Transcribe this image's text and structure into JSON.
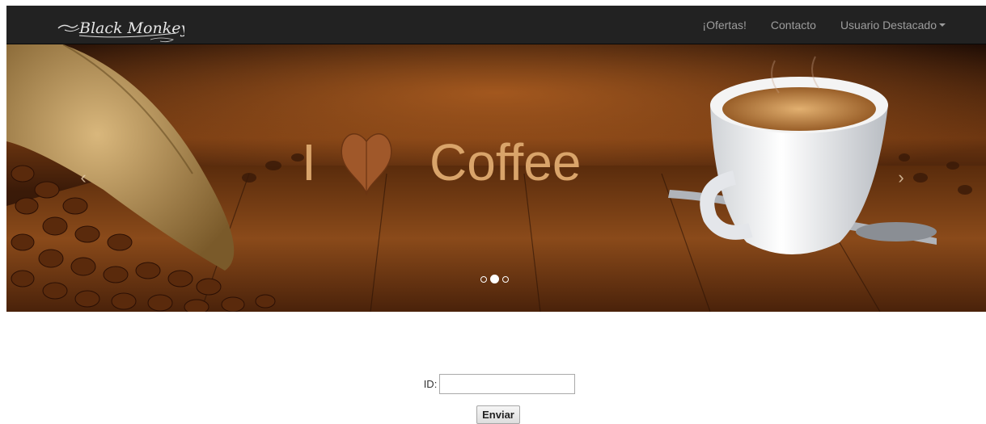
{
  "navbar": {
    "brand": "Black Monkey",
    "links": [
      {
        "label": "¡Ofertas!"
      },
      {
        "label": "Contacto"
      },
      {
        "label": "Usuario Destacado",
        "dropdown": true
      }
    ]
  },
  "carousel": {
    "slide_text_left": "I",
    "slide_text_right": "Coffee",
    "prev_icon": "chevron-left-icon",
    "next_icon": "chevron-right-icon",
    "indicator_count": 3,
    "active_indicator": 2
  },
  "form": {
    "id_label": "ID:",
    "id_value": "",
    "submit_label": "Enviar"
  },
  "colors": {
    "navbar_bg": "#222222",
    "nav_link": "#9d9d9d",
    "coffee_text": "#d9a46a"
  }
}
